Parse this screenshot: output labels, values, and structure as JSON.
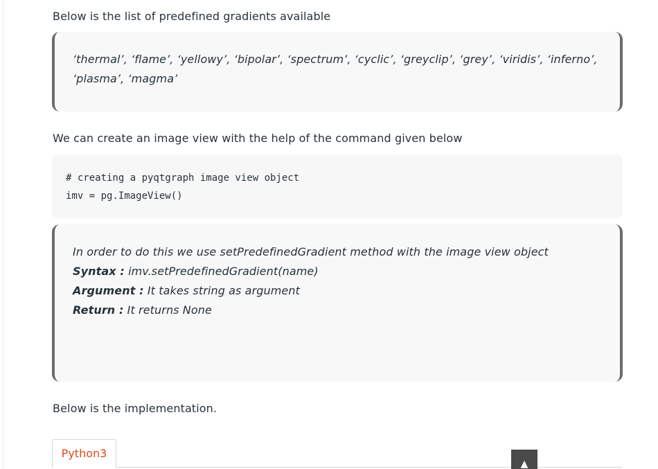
{
  "intro_text": "Below is the list of predefined gradients available",
  "gradients_list": "‘thermal’, ‘flame’, ‘yellowy’, ‘bipolar’, ‘spectrum’, ‘cyclic’, ‘greyclip’, ‘grey’, ‘viridis’, ‘inferno’, ‘plasma’, ‘magma’",
  "imageview_text": "We can create an image view with the help of the command given below",
  "code_lines": {
    "0": "# creating a pyqtgraph image view object",
    "1": "imv = pg.ImageView()"
  },
  "method_note": {
    "description": "In order to do this we use setPredefinedGradient method with the image view object",
    "syntax_label": "Syntax :",
    "syntax_value": " imv.setPredefinedGradient(name)",
    "argument_label": "Argument :",
    "argument_value": " It takes string as argument",
    "return_label": "Return :",
    "return_value": " It returns None"
  },
  "implementation_text": "Below is the implementation.",
  "tabs": {
    "0": {
      "label": "Python3"
    }
  },
  "scroll_top_symbol": "▲",
  "colors": {
    "text": "#273239",
    "accent_tab": "#e0491c",
    "quote_border": "#6b6b6b",
    "quote_bg": "#f8f8f8"
  }
}
